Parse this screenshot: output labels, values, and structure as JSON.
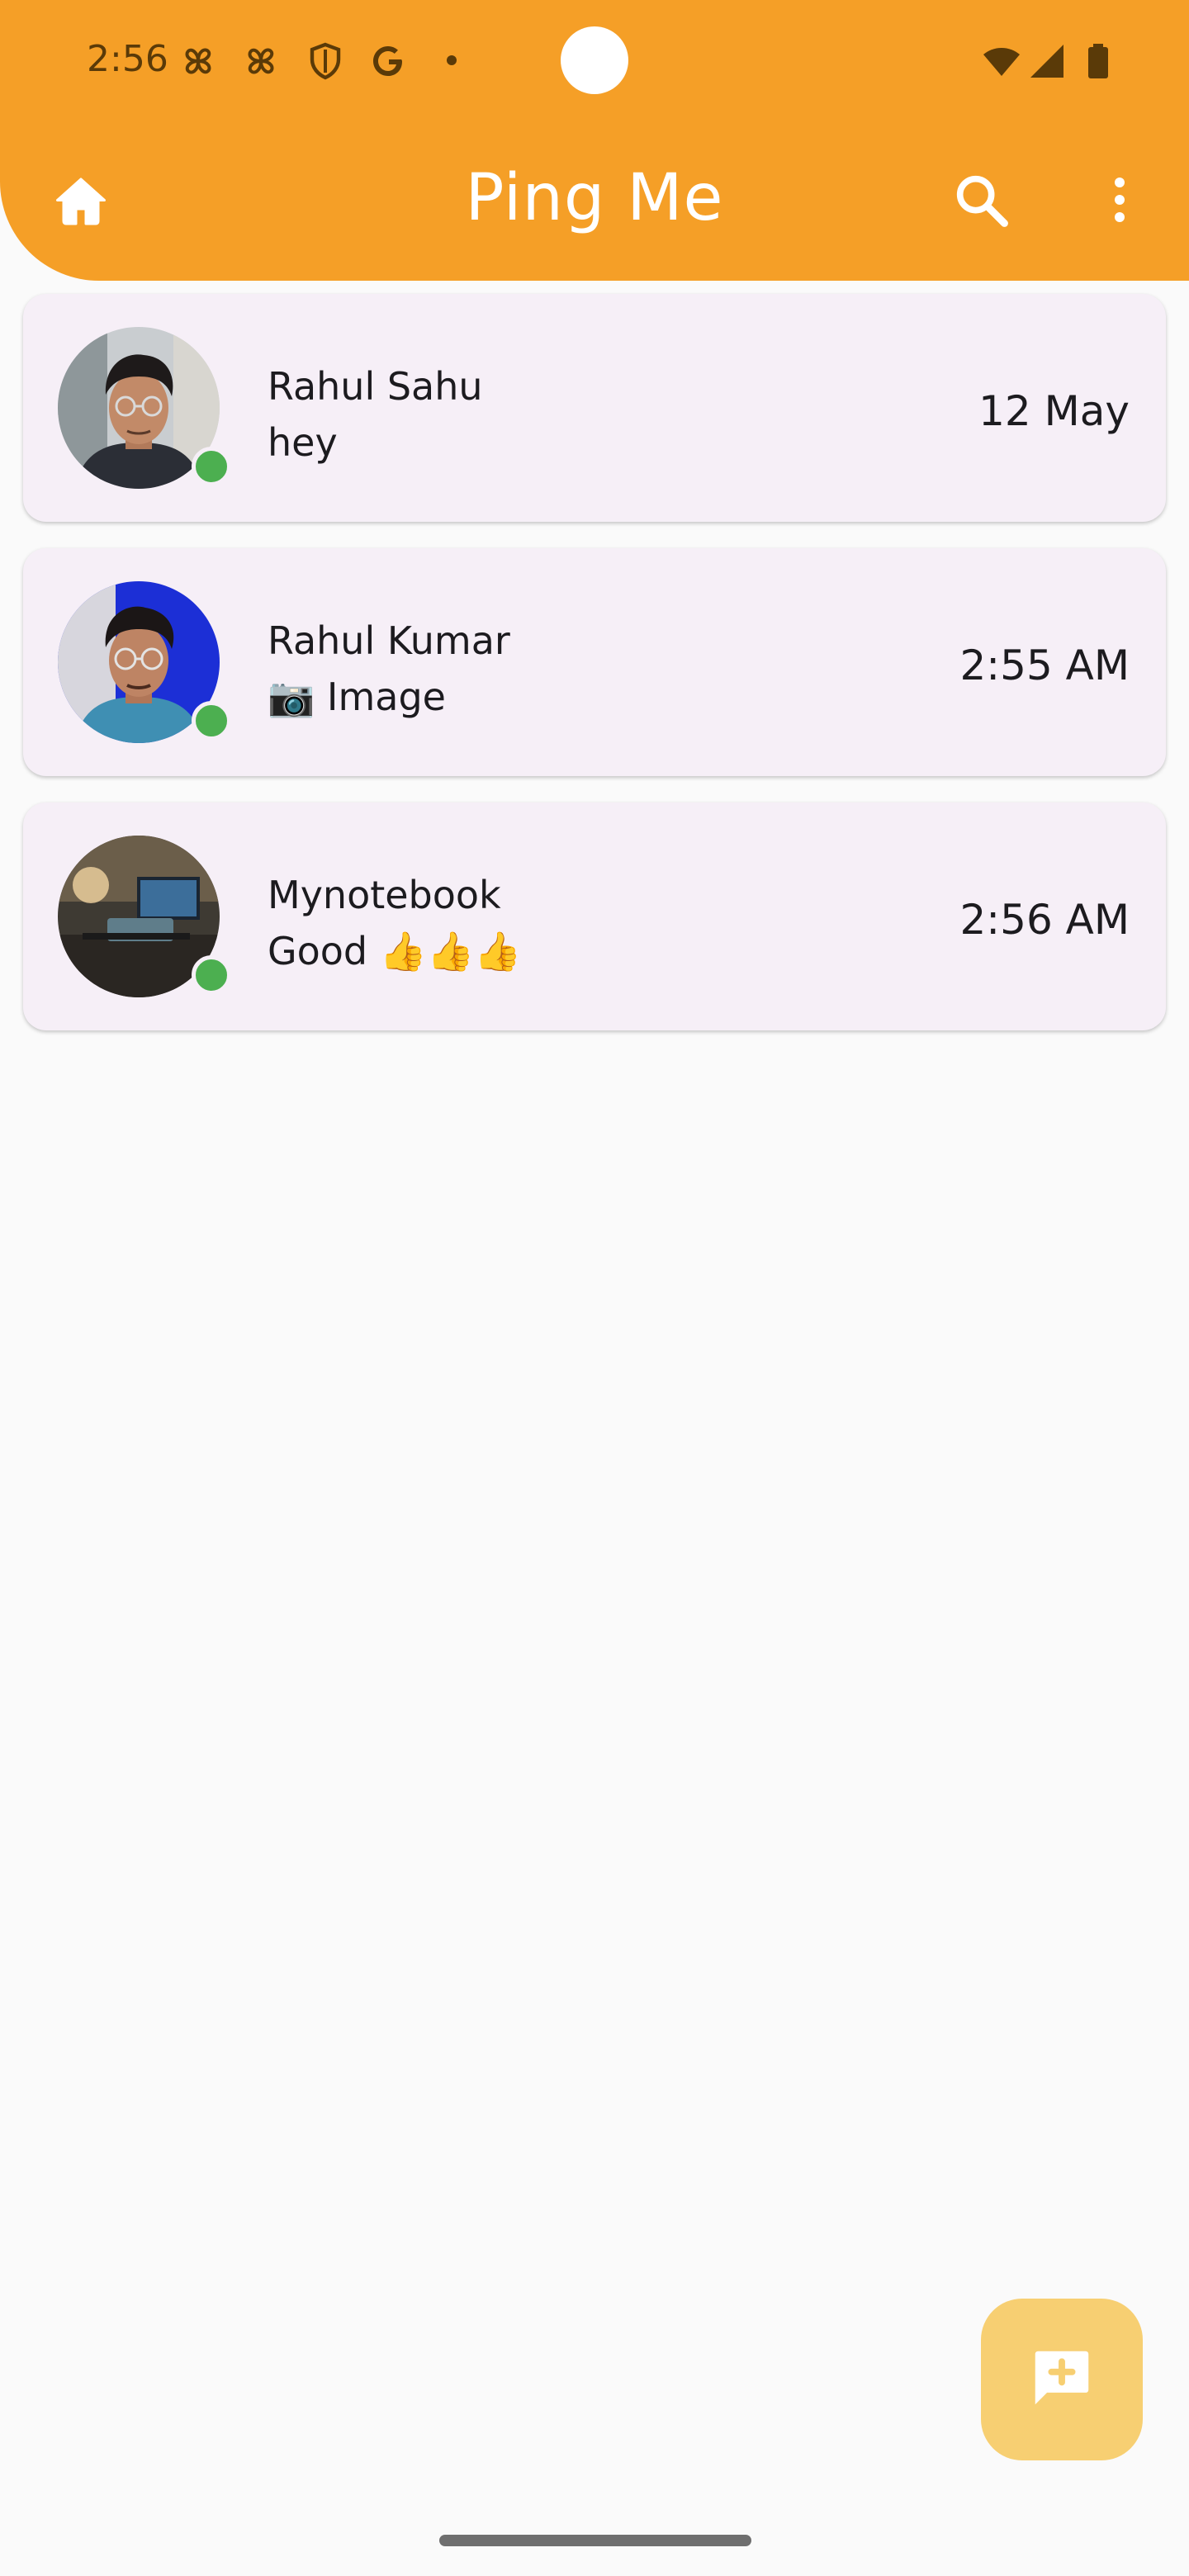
{
  "status_bar": {
    "time": "2:56",
    "icons": [
      "pinwheel-icon",
      "pinwheel-icon",
      "shield-icon",
      "google-icon",
      "wifi-icon",
      "signal-icon",
      "battery-icon"
    ]
  },
  "app_bar": {
    "title": "Ping Me",
    "background_color": "#f59f27",
    "left_icon": "home-icon",
    "right_icons": [
      "search-icon",
      "more-vert-icon"
    ]
  },
  "chats": [
    {
      "name": "Rahul Sahu",
      "message": "hey",
      "time": "12 May",
      "online": true
    },
    {
      "name": "Rahul Kumar",
      "message": "📷 Image",
      "time": "2:55 AM",
      "online": true
    },
    {
      "name": "Mynotebook",
      "message": "Good 👍👍👍",
      "time": "2:56 AM",
      "online": true
    }
  ],
  "fab": {
    "icon": "add-comment-icon",
    "color": "#f7cf72"
  },
  "colors": {
    "accent": "#f59f27",
    "card_background": "#f6eff7",
    "online": "#4caf50"
  }
}
